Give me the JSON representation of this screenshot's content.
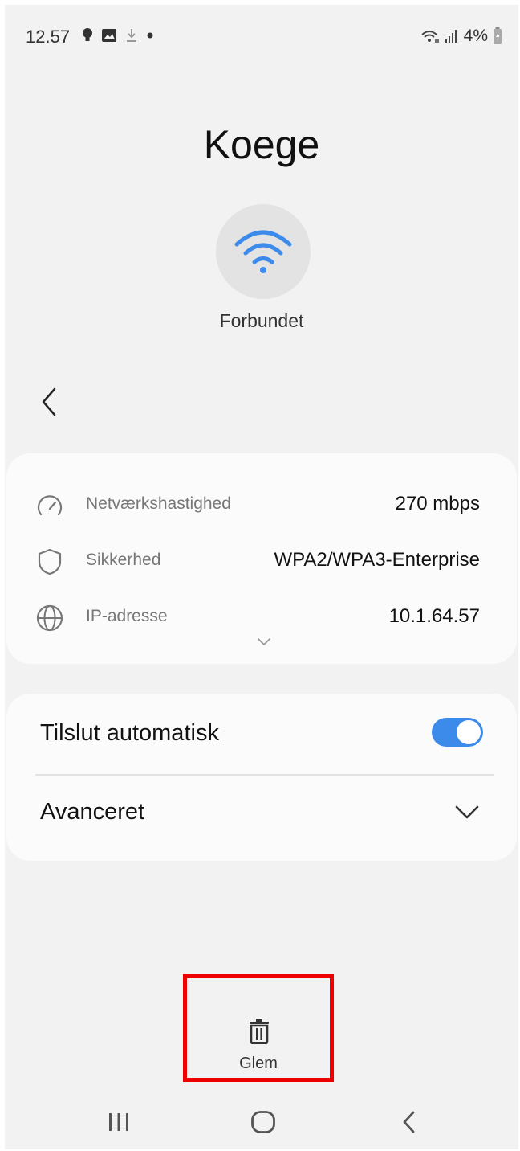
{
  "status_bar": {
    "time": "12.57",
    "left_icons": [
      "bulb-icon",
      "image-icon",
      "download-icon",
      "dot-icon"
    ],
    "right_icons": [
      "wifi-status-icon",
      "signal-icon",
      "battery-icon"
    ],
    "battery": "4%"
  },
  "network": {
    "name": "Koege",
    "status": "Forbundet",
    "icon": "wifi-icon",
    "accent_color": "#3c8bea"
  },
  "info": {
    "rows": [
      {
        "icon": "speed-icon",
        "label": "Netværkshastighed",
        "value": "270 mbps"
      },
      {
        "icon": "shield-icon",
        "label": "Sikkerhed",
        "value": "WPA2/WPA3-Enterprise"
      },
      {
        "icon": "globe-icon",
        "label": "IP-adresse",
        "value": "10.1.64.57"
      }
    ]
  },
  "settings": {
    "auto_connect_label": "Tilslut automatisk",
    "auto_connect_on": true,
    "advanced_label": "Avanceret"
  },
  "actions": {
    "forget_label": "Glem",
    "highlight_color": "#ee0000"
  },
  "navbar": {
    "icons": [
      "recent-apps-icon",
      "home-icon",
      "back-icon"
    ]
  }
}
